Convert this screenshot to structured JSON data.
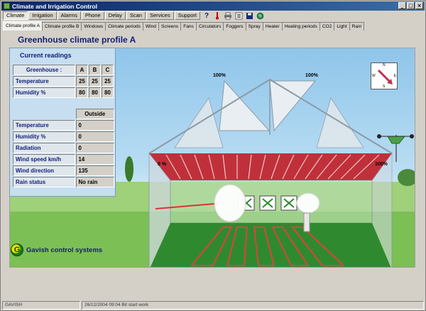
{
  "window": {
    "title": "Climate and Irrigation Control",
    "controls": [
      "_",
      "□",
      "×"
    ]
  },
  "menu": {
    "items": [
      "Climate",
      "Irrigation",
      "Alarms",
      "Phone",
      "Delay",
      "Scan",
      "Services",
      "Support"
    ],
    "active_index": 0,
    "help_icon": "?"
  },
  "tabs": {
    "items": [
      "Climate profile A",
      "Climate profile B",
      "Windows",
      "Climate periods",
      "Wind",
      "Screens",
      "Fans",
      "Circulators",
      "Foggers",
      "Spray",
      "Heater",
      "Heating periods",
      "CO2",
      "Light",
      "Rain"
    ],
    "active_index": 0
  },
  "page": {
    "title": "Greenhouse climate profile A"
  },
  "readings": {
    "title": "Current readings",
    "greenhouse_label": "Greenhouse :",
    "greenhouse_cols": [
      "A",
      "B",
      "C"
    ],
    "greenhouse_rows": [
      {
        "label": "Temperature",
        "values": [
          "25",
          "25",
          "25"
        ]
      },
      {
        "label": "Humidity  %",
        "values": [
          "80",
          "80",
          "80"
        ]
      }
    ],
    "outside_header": "Outside",
    "outside_rows": [
      {
        "label": "Temperature",
        "value": "0"
      },
      {
        "label": "Humidity  %",
        "value": "0"
      },
      {
        "label": "Radiation",
        "value": "0"
      },
      {
        "label": "Wind speed  km/h",
        "value": "14"
      },
      {
        "label": "Wind direction",
        "value": "135"
      },
      {
        "label": "Rain status",
        "value": "No rain"
      }
    ]
  },
  "scene": {
    "vent_left_pct": "100%",
    "vent_right_pct": "100%",
    "side_left_pct": "0 %",
    "side_right_pct": "100%",
    "compass": {
      "n": "N",
      "e": "E",
      "s": "S",
      "w": "W"
    }
  },
  "logo": {
    "mark": "G",
    "text": "Gavish control systems"
  },
  "status": {
    "user": "GAVISH",
    "message": "26/12/2004 09:04 Bit start work"
  },
  "colors": {
    "title_blue": "#13207a",
    "panel_bg": "#c6def0",
    "frame_red": "#c0303a",
    "field_green": "#2f8a2f"
  }
}
